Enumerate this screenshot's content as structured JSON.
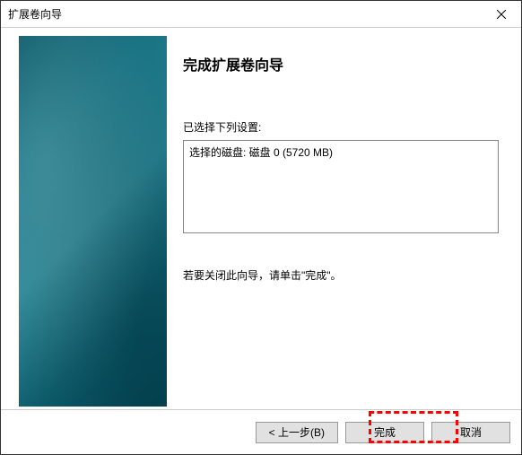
{
  "titlebar": {
    "title": "扩展卷向导"
  },
  "main": {
    "heading": "完成扩展卷向导",
    "settingsLabel": "已选择下列设置:",
    "settingsContent": "选择的磁盘: 磁盘 0 (5720 MB)",
    "instruction": "若要关闭此向导，请单击\"完成\"。"
  },
  "buttons": {
    "back": "< 上一步(B)",
    "finish": "完成",
    "cancel": "取消"
  }
}
